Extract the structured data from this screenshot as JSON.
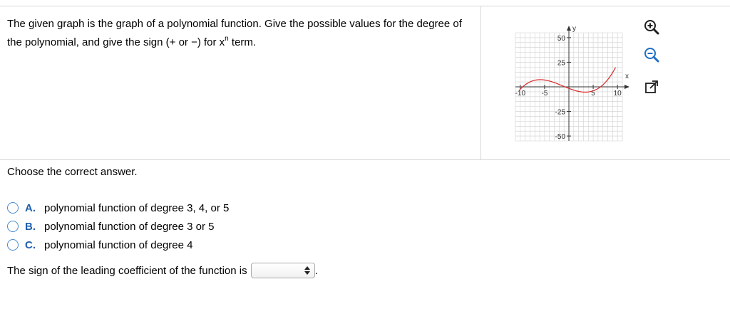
{
  "question": {
    "text_main": "The given graph is the graph of a polynomial function. Give the possible values for the degree of the polynomial, and give the sign (+ or −) for x",
    "text_exponent": "n",
    "text_end": " term."
  },
  "graph": {
    "x_axis_label": "x",
    "y_axis_label": "y",
    "x_tick_labels": [
      "-10",
      "-5",
      "5",
      "10"
    ],
    "y_tick_labels": [
      "50",
      "25",
      "-25",
      "-50"
    ],
    "curve_color": "#d62828"
  },
  "tools": [
    {
      "name": "zoom-in-icon",
      "symbol": "+"
    },
    {
      "name": "zoom-out-icon",
      "symbol": "−"
    },
    {
      "name": "popout-icon",
      "symbol": "↗"
    }
  ],
  "instruction": "Choose the correct answer.",
  "choices": [
    {
      "letter": "A.",
      "text": "polynomial function of degree 3, 4, or 5"
    },
    {
      "letter": "B.",
      "text": "polynomial function of degree 3 or 5"
    },
    {
      "letter": "C.",
      "text": "polynomial function of degree 4"
    }
  ],
  "sign_question": {
    "label": "The sign of the leading coefficient of the function is",
    "selected_value": "",
    "end": "."
  }
}
